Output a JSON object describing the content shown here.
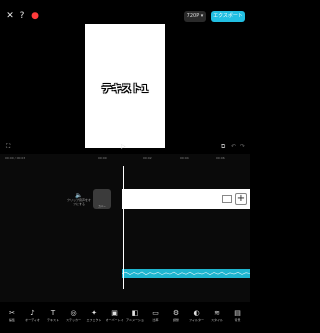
{
  "topbar": {
    "close_icon": "close-icon",
    "help_icon": "help-icon",
    "flame_icon": "flame-icon",
    "resolution_label": "720P",
    "export_label": "エクスポート"
  },
  "preview": {
    "text": "テキスト1"
  },
  "player": {
    "fullscreen_icon": "fullscreen-icon",
    "play_icon": "play-icon",
    "undo_icon": "undo-icon",
    "redo_icon": "redo-icon",
    "time": "00:00 / 00:03"
  },
  "timeline": {
    "cover_label": "カバー",
    "audio_control_label": "クリップ音声をオフにする",
    "ruler": [
      "00:00",
      "00:02",
      "00:04",
      "00:06"
    ]
  },
  "toolbar": {
    "items": [
      {
        "icon": "✂",
        "label": "編集"
      },
      {
        "icon": "♪",
        "label": "オーディオ"
      },
      {
        "icon": "T",
        "label": "テキスト"
      },
      {
        "icon": "◎",
        "label": "ステッカー"
      },
      {
        "icon": "✦",
        "label": "エフェクト"
      },
      {
        "icon": "▣",
        "label": "オーバーレイ"
      },
      {
        "icon": "◧",
        "label": "アニメーション"
      },
      {
        "icon": "▭",
        "label": "比率"
      },
      {
        "icon": "⚙",
        "label": "調整"
      },
      {
        "icon": "◐",
        "label": "フィルター"
      },
      {
        "icon": "≋",
        "label": "スタイル"
      },
      {
        "icon": "▤",
        "label": "背景"
      }
    ]
  },
  "colors": {
    "accent": "#22bfe2",
    "audio_track": "#1fb6d0"
  }
}
